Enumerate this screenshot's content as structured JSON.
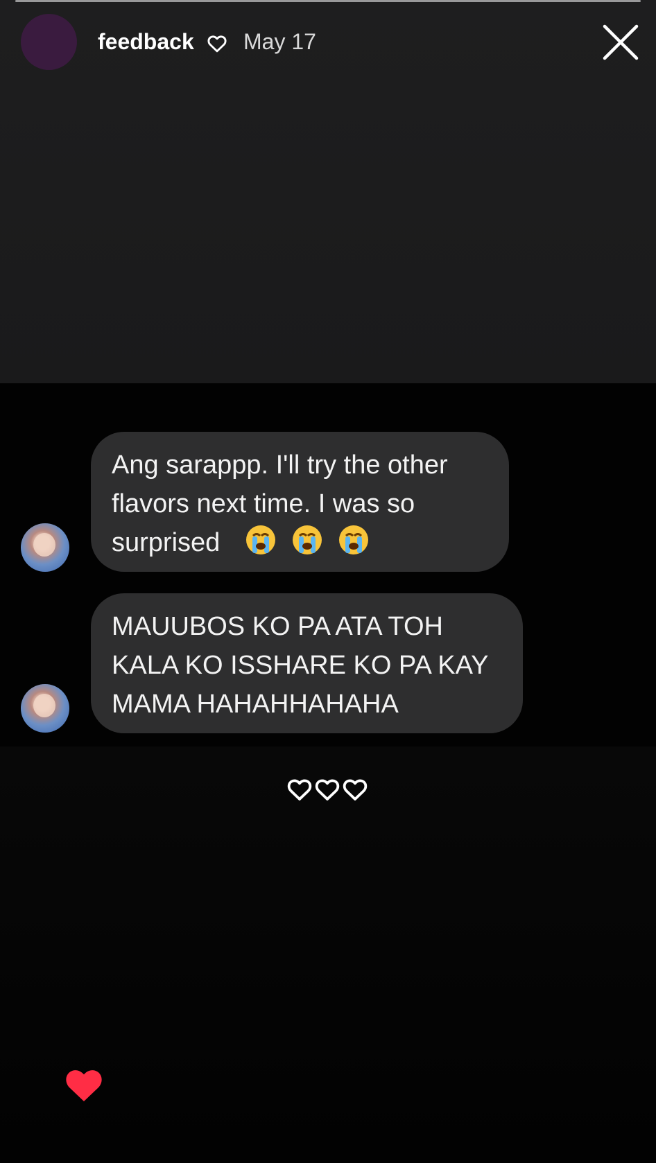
{
  "header": {
    "username": "feedback",
    "date": "May 17",
    "close_icon": "close-icon",
    "heart_icon": "heart-outline-icon"
  },
  "messages": [
    {
      "lines": [
        "Ang sarappp. I'll try the other",
        "flavors next time. I was so",
        "surprised"
      ],
      "emoji_icons": [
        "loudly-crying-face-icon",
        "loudly-crying-face-icon",
        "loudly-crying-face-icon"
      ]
    },
    {
      "lines": [
        "MAUUBOS KO PA ATA TOH",
        "KALA KO ISSHARE KO PA KAY",
        "MAMA HAHAHHAHAHA"
      ]
    }
  ],
  "reactions": {
    "count": 3,
    "icon": "heart-outline-icon"
  },
  "footer": {
    "like_icon": "heart-filled-icon",
    "like_color": "#ff2d45"
  },
  "colors": {
    "background_top": "#1e1e1f",
    "bubble": "#2e2e2f",
    "avatar": "#3a1b3f"
  }
}
